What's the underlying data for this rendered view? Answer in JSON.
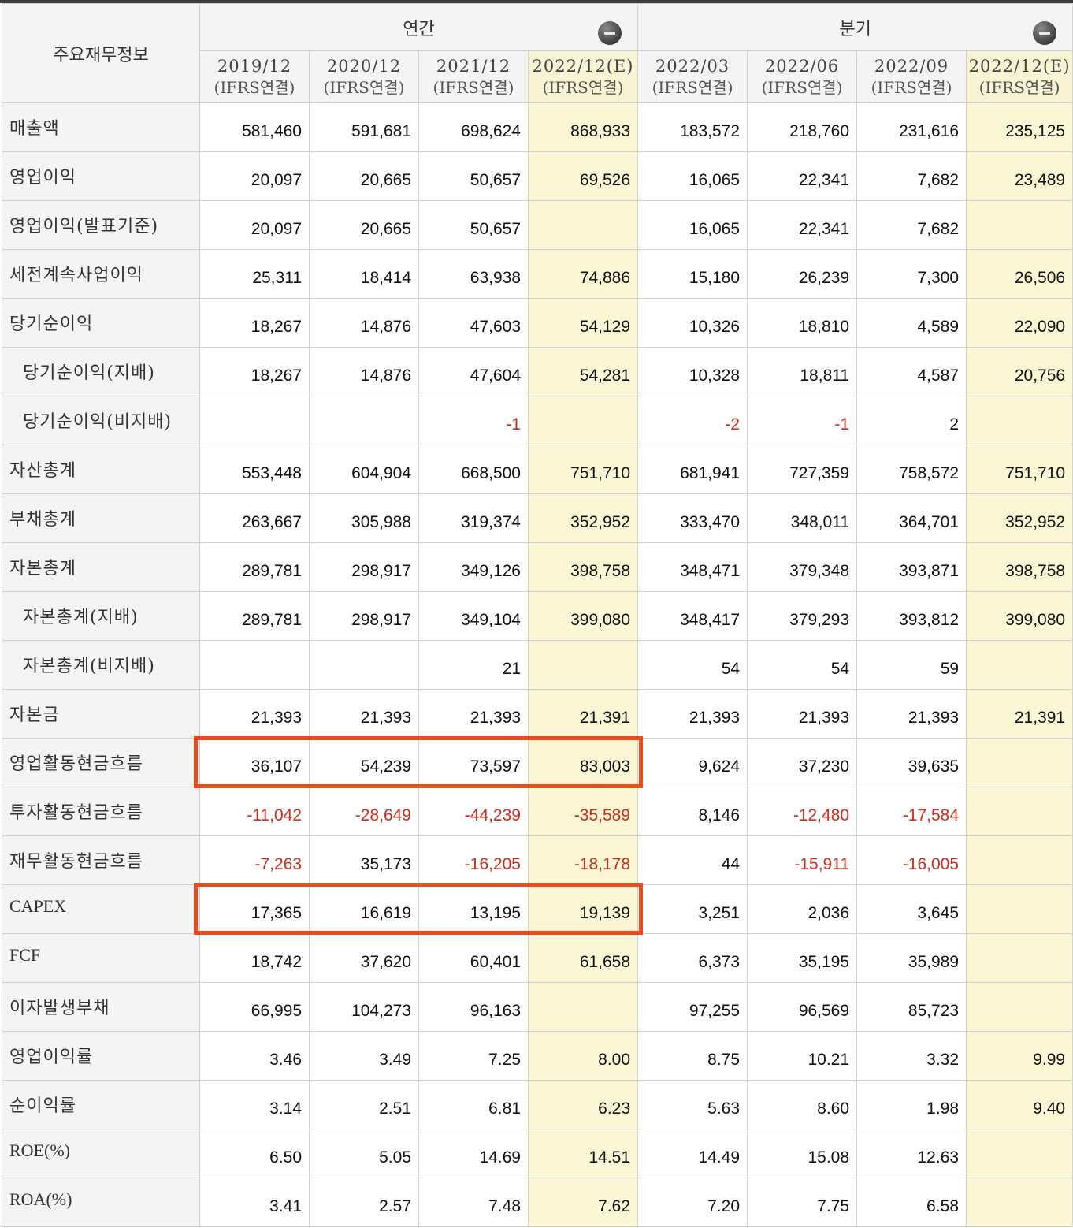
{
  "header": {
    "corner": "주요재무정보",
    "annual_label": "연간",
    "quarterly_label": "분기",
    "collapse_icon": "minus-circle-icon",
    "periods": [
      {
        "date": "2019/12",
        "std": "(IFRS연결)"
      },
      {
        "date": "2020/12",
        "std": "(IFRS연결)"
      },
      {
        "date": "2021/12",
        "std": "(IFRS연결)"
      },
      {
        "date": "2022/12(E)",
        "std": "(IFRS연결)"
      },
      {
        "date": "2022/03",
        "std": "(IFRS연결)"
      },
      {
        "date": "2022/06",
        "std": "(IFRS연결)"
      },
      {
        "date": "2022/09",
        "std": "(IFRS연결)"
      },
      {
        "date": "2022/12(E)",
        "std": "(IFRS연결)"
      }
    ]
  },
  "colors": {
    "negative": "#d22a1a",
    "estimate_bg": "#fbf6d4",
    "highlight_box": "#ec4a1e"
  },
  "highlighted_rows": [
    "영업활동현금흐름",
    "CAPEX"
  ],
  "rows": [
    {
      "label": "매출액",
      "values": [
        "581,460",
        "591,681",
        "698,624",
        "868,933",
        "183,572",
        "218,760",
        "231,616",
        "235,125"
      ]
    },
    {
      "label": "영업이익",
      "values": [
        "20,097",
        "20,665",
        "50,657",
        "69,526",
        "16,065",
        "22,341",
        "7,682",
        "23,489"
      ]
    },
    {
      "label": "영업이익(발표기준)",
      "values": [
        "20,097",
        "20,665",
        "50,657",
        "",
        "16,065",
        "22,341",
        "7,682",
        ""
      ]
    },
    {
      "label": "세전계속사업이익",
      "values": [
        "25,311",
        "18,414",
        "63,938",
        "74,886",
        "15,180",
        "26,239",
        "7,300",
        "26,506"
      ]
    },
    {
      "label": "당기순이익",
      "values": [
        "18,267",
        "14,876",
        "47,603",
        "54,129",
        "10,326",
        "18,810",
        "4,589",
        "22,090"
      ]
    },
    {
      "label": "당기순이익(지배)",
      "values": [
        "18,267",
        "14,876",
        "47,604",
        "54,281",
        "10,328",
        "18,811",
        "4,587",
        "20,756"
      ]
    },
    {
      "label": "당기순이익(비지배)",
      "values": [
        "",
        "",
        "-1",
        "",
        "-2",
        "-1",
        "2",
        ""
      ]
    },
    {
      "label": "자산총계",
      "values": [
        "553,448",
        "604,904",
        "668,500",
        "751,710",
        "681,941",
        "727,359",
        "758,572",
        "751,710"
      ]
    },
    {
      "label": "부채총계",
      "values": [
        "263,667",
        "305,988",
        "319,374",
        "352,952",
        "333,470",
        "348,011",
        "364,701",
        "352,952"
      ]
    },
    {
      "label": "자본총계",
      "values": [
        "289,781",
        "298,917",
        "349,126",
        "398,758",
        "348,471",
        "379,348",
        "393,871",
        "398,758"
      ]
    },
    {
      "label": "자본총계(지배)",
      "values": [
        "289,781",
        "298,917",
        "349,104",
        "399,080",
        "348,417",
        "379,293",
        "393,812",
        "399,080"
      ]
    },
    {
      "label": "자본총계(비지배)",
      "values": [
        "",
        "",
        "21",
        "",
        "54",
        "54",
        "59",
        ""
      ]
    },
    {
      "label": "자본금",
      "values": [
        "21,393",
        "21,393",
        "21,393",
        "21,391",
        "21,393",
        "21,393",
        "21,393",
        "21,391"
      ]
    },
    {
      "label": "영업활동현금흐름",
      "values": [
        "36,107",
        "54,239",
        "73,597",
        "83,003",
        "9,624",
        "37,230",
        "39,635",
        ""
      ]
    },
    {
      "label": "투자활동현금흐름",
      "values": [
        "-11,042",
        "-28,649",
        "-44,239",
        "-35,589",
        "8,146",
        "-12,480",
        "-17,584",
        ""
      ]
    },
    {
      "label": "재무활동현금흐름",
      "values": [
        "-7,263",
        "35,173",
        "-16,205",
        "-18,178",
        "44",
        "-15,911",
        "-16,005",
        ""
      ]
    },
    {
      "label": "CAPEX",
      "values": [
        "17,365",
        "16,619",
        "13,195",
        "19,139",
        "3,251",
        "2,036",
        "3,645",
        ""
      ]
    },
    {
      "label": "FCF",
      "values": [
        "18,742",
        "37,620",
        "60,401",
        "61,658",
        "6,373",
        "35,195",
        "35,989",
        ""
      ]
    },
    {
      "label": "이자발생부채",
      "values": [
        "66,995",
        "104,273",
        "96,163",
        "",
        "97,255",
        "96,569",
        "85,723",
        ""
      ]
    },
    {
      "label": "영업이익률",
      "values": [
        "3.46",
        "3.49",
        "7.25",
        "8.00",
        "8.75",
        "10.21",
        "3.32",
        "9.99"
      ]
    },
    {
      "label": "순이익률",
      "values": [
        "3.14",
        "2.51",
        "6.81",
        "6.23",
        "5.63",
        "8.60",
        "1.98",
        "9.40"
      ]
    },
    {
      "label": "ROE(%)",
      "values": [
        "6.50",
        "5.05",
        "14.69",
        "14.51",
        "14.49",
        "15.08",
        "12.63",
        ""
      ]
    },
    {
      "label": "ROA(%)",
      "values": [
        "3.41",
        "2.57",
        "7.48",
        "7.62",
        "7.20",
        "7.75",
        "6.58",
        ""
      ]
    }
  ]
}
